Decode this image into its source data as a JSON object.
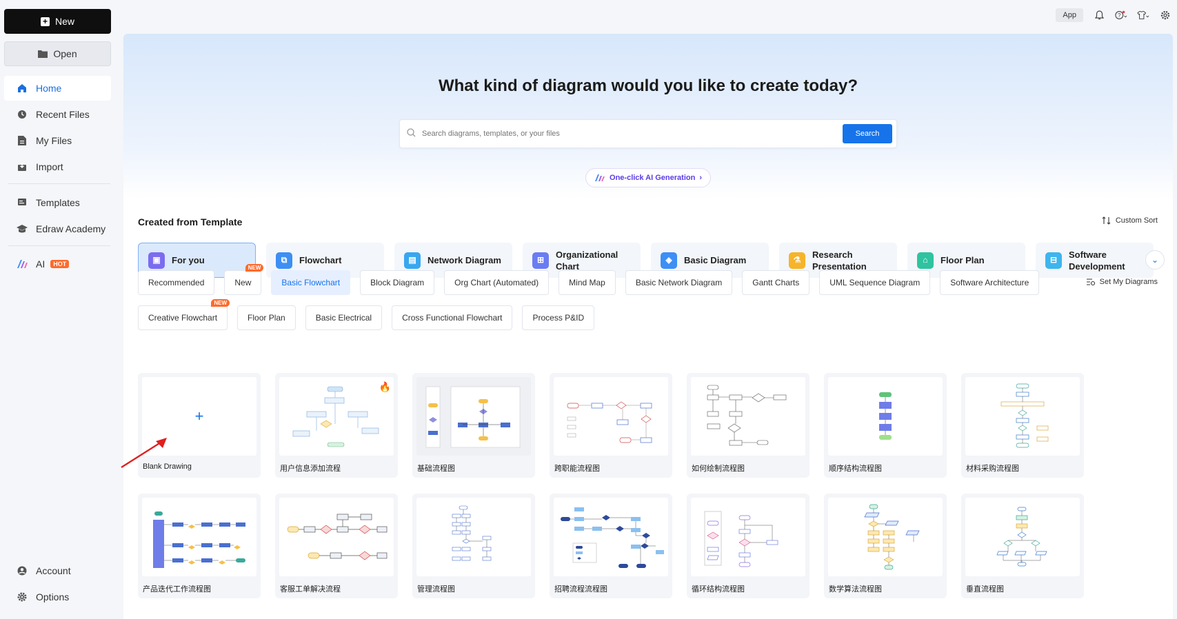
{
  "sidebar": {
    "new_label": "New",
    "open_label": "Open",
    "nav": [
      {
        "label": "Home",
        "icon": "home-icon",
        "active": true
      },
      {
        "label": "Recent Files",
        "icon": "clock-icon"
      },
      {
        "label": "My Files",
        "icon": "file-icon"
      },
      {
        "label": "Import",
        "icon": "import-icon"
      },
      {
        "label": "Templates",
        "icon": "templates-icon"
      },
      {
        "label": "Edraw Academy",
        "icon": "academy-icon"
      },
      {
        "label": "AI",
        "icon": "ai-icon",
        "badge": "HOT"
      }
    ],
    "bottom": [
      {
        "label": "Account",
        "icon": "account-icon"
      },
      {
        "label": "Options",
        "icon": "gear-icon"
      }
    ]
  },
  "topbar": {
    "app_label": "App"
  },
  "hero": {
    "title": "What kind of diagram would you like to create today?",
    "search_placeholder": "Search diagrams, templates, or your files",
    "search_button": "Search",
    "ai_label": "One-click AI Generation"
  },
  "section": {
    "title": "Created from Template",
    "custom_sort": "Custom Sort",
    "set_diagrams": "Set My Diagrams"
  },
  "categories": [
    {
      "label": "For you",
      "color": "#7b6cf0",
      "active": true
    },
    {
      "label": "Flowchart",
      "color": "#3d8ff5"
    },
    {
      "label": "Network Diagram",
      "color": "#37a7f0"
    },
    {
      "label": "Organizational Chart",
      "color": "#6a7cf2"
    },
    {
      "label": "Basic Diagram",
      "color": "#3d8ff5"
    },
    {
      "label": "Research Presentation",
      "color": "#f5b42a"
    },
    {
      "label": "Floor Plan",
      "color": "#2fc3a0"
    },
    {
      "label": "Software Development",
      "color": "#3db5ee"
    }
  ],
  "tags_row1": [
    {
      "label": "Recommended"
    },
    {
      "label": "New",
      "badge": "NEW"
    },
    {
      "label": "Basic Flowchart",
      "active": true
    },
    {
      "label": "Block Diagram"
    },
    {
      "label": "Org Chart (Automated)"
    },
    {
      "label": "Mind Map"
    },
    {
      "label": "Basic Network Diagram"
    },
    {
      "label": "Gantt Charts"
    },
    {
      "label": "UML Sequence Diagram"
    },
    {
      "label": "Software Architecture"
    }
  ],
  "tags_row2": [
    {
      "label": "Creative Flowchart",
      "badge": "NEW"
    },
    {
      "label": "Floor Plan"
    },
    {
      "label": "Basic Electrical"
    },
    {
      "label": "Cross Functional Flowchart"
    },
    {
      "label": "Process P&ID"
    }
  ],
  "templates": [
    {
      "label": "Blank Drawing",
      "blank": true
    },
    {
      "label": "用户信息添加流程",
      "hot": true
    },
    {
      "label": "基础流程图"
    },
    {
      "label": "跨职能流程图"
    },
    {
      "label": "如何绘制流程图"
    },
    {
      "label": "顺序结构流程图"
    },
    {
      "label": "材料采购流程图"
    },
    {
      "label": "产品迭代工作流程图"
    },
    {
      "label": "客服工单解决流程"
    },
    {
      "label": "管理流程图"
    },
    {
      "label": "招聘流程流程图"
    },
    {
      "label": "循环结构流程图"
    },
    {
      "label": "数学算法流程图"
    },
    {
      "label": "垂直流程图"
    }
  ]
}
